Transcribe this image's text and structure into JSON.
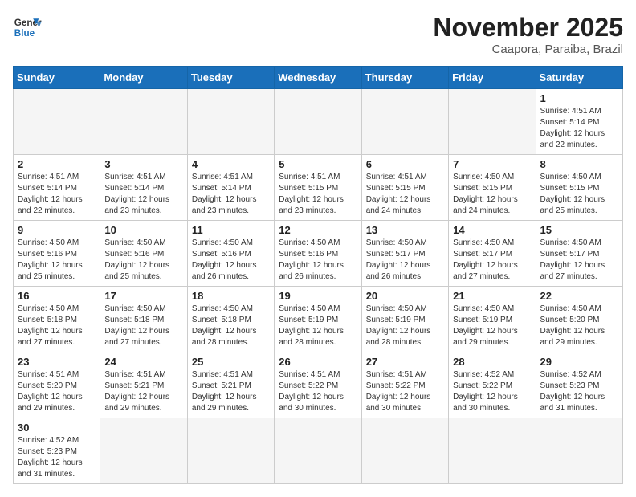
{
  "header": {
    "logo_general": "General",
    "logo_blue": "Blue",
    "month_title": "November 2025",
    "subtitle": "Caapora, Paraiba, Brazil"
  },
  "weekdays": [
    "Sunday",
    "Monday",
    "Tuesday",
    "Wednesday",
    "Thursday",
    "Friday",
    "Saturday"
  ],
  "weeks": [
    [
      {
        "day": "",
        "info": ""
      },
      {
        "day": "",
        "info": ""
      },
      {
        "day": "",
        "info": ""
      },
      {
        "day": "",
        "info": ""
      },
      {
        "day": "",
        "info": ""
      },
      {
        "day": "",
        "info": ""
      },
      {
        "day": "1",
        "info": "Sunrise: 4:51 AM\nSunset: 5:14 PM\nDaylight: 12 hours\nand 22 minutes."
      }
    ],
    [
      {
        "day": "2",
        "info": "Sunrise: 4:51 AM\nSunset: 5:14 PM\nDaylight: 12 hours\nand 22 minutes."
      },
      {
        "day": "3",
        "info": "Sunrise: 4:51 AM\nSunset: 5:14 PM\nDaylight: 12 hours\nand 23 minutes."
      },
      {
        "day": "4",
        "info": "Sunrise: 4:51 AM\nSunset: 5:14 PM\nDaylight: 12 hours\nand 23 minutes."
      },
      {
        "day": "5",
        "info": "Sunrise: 4:51 AM\nSunset: 5:15 PM\nDaylight: 12 hours\nand 23 minutes."
      },
      {
        "day": "6",
        "info": "Sunrise: 4:51 AM\nSunset: 5:15 PM\nDaylight: 12 hours\nand 24 minutes."
      },
      {
        "day": "7",
        "info": "Sunrise: 4:50 AM\nSunset: 5:15 PM\nDaylight: 12 hours\nand 24 minutes."
      },
      {
        "day": "8",
        "info": "Sunrise: 4:50 AM\nSunset: 5:15 PM\nDaylight: 12 hours\nand 25 minutes."
      }
    ],
    [
      {
        "day": "9",
        "info": "Sunrise: 4:50 AM\nSunset: 5:16 PM\nDaylight: 12 hours\nand 25 minutes."
      },
      {
        "day": "10",
        "info": "Sunrise: 4:50 AM\nSunset: 5:16 PM\nDaylight: 12 hours\nand 25 minutes."
      },
      {
        "day": "11",
        "info": "Sunrise: 4:50 AM\nSunset: 5:16 PM\nDaylight: 12 hours\nand 26 minutes."
      },
      {
        "day": "12",
        "info": "Sunrise: 4:50 AM\nSunset: 5:16 PM\nDaylight: 12 hours\nand 26 minutes."
      },
      {
        "day": "13",
        "info": "Sunrise: 4:50 AM\nSunset: 5:17 PM\nDaylight: 12 hours\nand 26 minutes."
      },
      {
        "day": "14",
        "info": "Sunrise: 4:50 AM\nSunset: 5:17 PM\nDaylight: 12 hours\nand 27 minutes."
      },
      {
        "day": "15",
        "info": "Sunrise: 4:50 AM\nSunset: 5:17 PM\nDaylight: 12 hours\nand 27 minutes."
      }
    ],
    [
      {
        "day": "16",
        "info": "Sunrise: 4:50 AM\nSunset: 5:18 PM\nDaylight: 12 hours\nand 27 minutes."
      },
      {
        "day": "17",
        "info": "Sunrise: 4:50 AM\nSunset: 5:18 PM\nDaylight: 12 hours\nand 27 minutes."
      },
      {
        "day": "18",
        "info": "Sunrise: 4:50 AM\nSunset: 5:18 PM\nDaylight: 12 hours\nand 28 minutes."
      },
      {
        "day": "19",
        "info": "Sunrise: 4:50 AM\nSunset: 5:19 PM\nDaylight: 12 hours\nand 28 minutes."
      },
      {
        "day": "20",
        "info": "Sunrise: 4:50 AM\nSunset: 5:19 PM\nDaylight: 12 hours\nand 28 minutes."
      },
      {
        "day": "21",
        "info": "Sunrise: 4:50 AM\nSunset: 5:19 PM\nDaylight: 12 hours\nand 29 minutes."
      },
      {
        "day": "22",
        "info": "Sunrise: 4:50 AM\nSunset: 5:20 PM\nDaylight: 12 hours\nand 29 minutes."
      }
    ],
    [
      {
        "day": "23",
        "info": "Sunrise: 4:51 AM\nSunset: 5:20 PM\nDaylight: 12 hours\nand 29 minutes."
      },
      {
        "day": "24",
        "info": "Sunrise: 4:51 AM\nSunset: 5:21 PM\nDaylight: 12 hours\nand 29 minutes."
      },
      {
        "day": "25",
        "info": "Sunrise: 4:51 AM\nSunset: 5:21 PM\nDaylight: 12 hours\nand 29 minutes."
      },
      {
        "day": "26",
        "info": "Sunrise: 4:51 AM\nSunset: 5:22 PM\nDaylight: 12 hours\nand 30 minutes."
      },
      {
        "day": "27",
        "info": "Sunrise: 4:51 AM\nSunset: 5:22 PM\nDaylight: 12 hours\nand 30 minutes."
      },
      {
        "day": "28",
        "info": "Sunrise: 4:52 AM\nSunset: 5:22 PM\nDaylight: 12 hours\nand 30 minutes."
      },
      {
        "day": "29",
        "info": "Sunrise: 4:52 AM\nSunset: 5:23 PM\nDaylight: 12 hours\nand 31 minutes."
      }
    ],
    [
      {
        "day": "30",
        "info": "Sunrise: 4:52 AM\nSunset: 5:23 PM\nDaylight: 12 hours\nand 31 minutes."
      },
      {
        "day": "",
        "info": ""
      },
      {
        "day": "",
        "info": ""
      },
      {
        "day": "",
        "info": ""
      },
      {
        "day": "",
        "info": ""
      },
      {
        "day": "",
        "info": ""
      },
      {
        "day": "",
        "info": ""
      }
    ]
  ]
}
